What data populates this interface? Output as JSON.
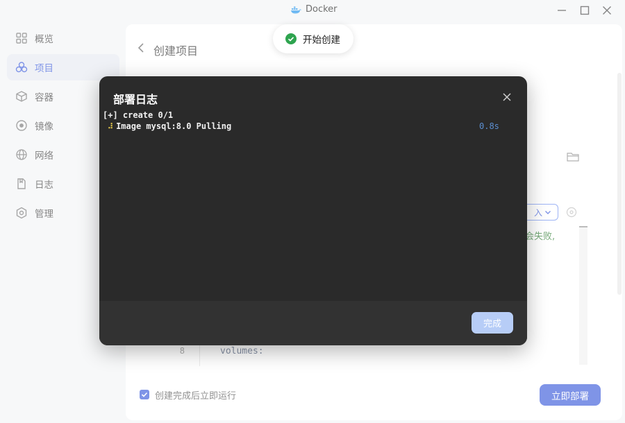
{
  "window": {
    "title": "Docker"
  },
  "sidebar": {
    "items": [
      {
        "label": "概览",
        "icon": "grid-icon",
        "active": false
      },
      {
        "label": "项目",
        "icon": "project-icon",
        "active": true
      },
      {
        "label": "容器",
        "icon": "container-icon",
        "active": false
      },
      {
        "label": "镜像",
        "icon": "image-icon",
        "active": false
      },
      {
        "label": "网络",
        "icon": "globe-icon",
        "active": false
      },
      {
        "label": "日志",
        "icon": "log-icon",
        "active": false
      },
      {
        "label": "管理",
        "icon": "settings-icon",
        "active": false
      }
    ]
  },
  "main": {
    "page_title": "创建项目",
    "import_label": "入",
    "warning_tail": "会失败,",
    "editor": {
      "line_number": "8",
      "code": "volumes:"
    },
    "run_after_create_label": "创建完成后立即运行",
    "run_after_create_checked": true,
    "deploy_button": "立即部署"
  },
  "toast": {
    "text": "开始创建",
    "icon": "success-check-icon"
  },
  "modal": {
    "title": "部署日志",
    "log": {
      "line1": "[+] create 0/1",
      "line2": "Image mysql:8.0 Pulling",
      "line2_time": "0.8s"
    },
    "done_button": "完成"
  },
  "colors": {
    "accent": "#3b5bdb",
    "modal_bg": "#2b2b2b",
    "success": "#2ea44f",
    "log_time": "#5b8fd1"
  }
}
